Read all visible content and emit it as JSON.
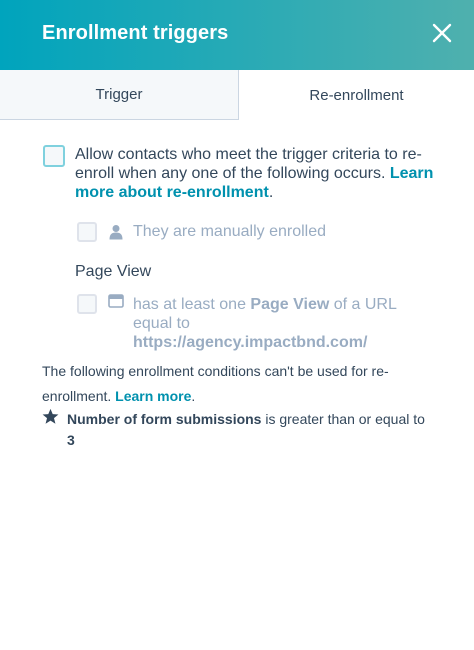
{
  "header": {
    "title": "Enrollment triggers",
    "close_icon": "close-icon"
  },
  "tabs": [
    {
      "label": "Trigger",
      "active": false
    },
    {
      "label": "Re-enrollment",
      "active": true
    }
  ],
  "reenroll": {
    "checked": false,
    "text": "Allow contacts who meet the trigger criteria to re-enroll when any one of the following occurs.",
    "link": "Learn more about re-enrollment",
    "after_link": "."
  },
  "options": {
    "manual": {
      "icon": "person-icon",
      "label": "They are manually enrolled",
      "checked": false
    },
    "page_view": {
      "heading": "Page View",
      "icon": "browser-window-icon",
      "text_before": "has at least one",
      "bold": "Page View",
      "text_after": "of a URL equal to",
      "url": "https://agency.impactbnd.com/",
      "checked": false
    }
  },
  "note": {
    "text": "The following enrollment conditions can't be used for re-enrollment.",
    "link": "Learn more",
    "after_link": "."
  },
  "condition": {
    "icon": "star-icon",
    "bold": "Number of form submissions",
    "text": "is greater than or equal to",
    "value": "3"
  },
  "colors": {
    "header_start": "#00a4bd",
    "header_end": "#4fb0ae",
    "link": "#0091ae",
    "text": "#33475b",
    "muted": "#99acc2"
  }
}
